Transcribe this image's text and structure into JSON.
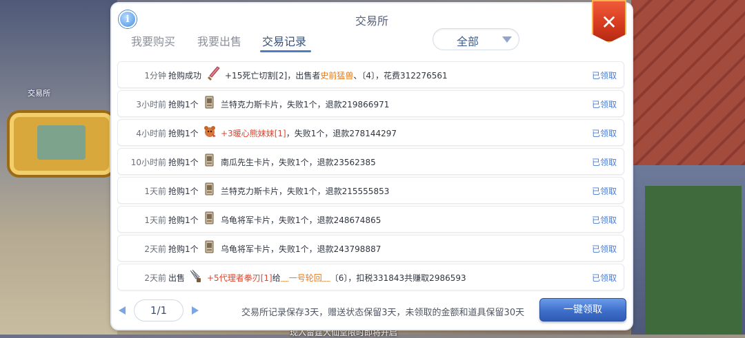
{
  "window": {
    "title": "交易所"
  },
  "tabs": [
    {
      "label": "我要购买",
      "active": false
    },
    {
      "label": "我要出售",
      "active": false
    },
    {
      "label": "交易记录",
      "active": true
    }
  ],
  "filter": {
    "selected": "全部"
  },
  "background": {
    "sign_label": "交易所",
    "bottom_text": "现入雷霆大仙堂限时即将开启"
  },
  "records": [
    {
      "time": "1分钟",
      "action": "抢购成功",
      "icon": "sword-icon",
      "desc_parts": [
        {
          "text": "+15死亡切割[2]，出售者"
        },
        {
          "text": "史前猛兽",
          "color": "orange"
        },
        {
          "text": "、〔4〕，花费312276561"
        }
      ],
      "status": "已领取"
    },
    {
      "time": "3小时前",
      "action": "抢购1个",
      "icon": "card-icon",
      "desc_parts": [
        {
          "text": "兰特克力斯卡片，失败1个，退款219866971"
        }
      ],
      "status": "已领取"
    },
    {
      "time": "4小时前",
      "action": "抢购1个",
      "icon": "bear-icon",
      "desc_parts": [
        {
          "text": "+3暖心熊妹妹[1]",
          "color": "red"
        },
        {
          "text": "，失败1个，退款278144297"
        }
      ],
      "status": "已领取"
    },
    {
      "time": "10小时前",
      "action": "抢购1个",
      "icon": "card-icon",
      "desc_parts": [
        {
          "text": "南瓜先生卡片，失败1个，退款23562385"
        }
      ],
      "status": "已领取"
    },
    {
      "time": "1天前",
      "action": "抢购1个",
      "icon": "card-icon",
      "desc_parts": [
        {
          "text": "兰特克力斯卡片，失败1个，退款215555853"
        }
      ],
      "status": "已领取"
    },
    {
      "time": "1天前",
      "action": "抢购1个",
      "icon": "card-icon",
      "desc_parts": [
        {
          "text": "乌龟将军卡片，失败1个，退款248674865"
        }
      ],
      "status": "已领取"
    },
    {
      "time": "2天前",
      "action": "抢购1个",
      "icon": "card-icon",
      "desc_parts": [
        {
          "text": "乌龟将军卡片，失败1个，退款243798887"
        }
      ],
      "status": "已领取"
    },
    {
      "time": "2天前",
      "action": "出售",
      "icon": "claw-icon",
      "desc_parts": [
        {
          "text": "+5代理者拳刃[1]",
          "color": "red"
        },
        {
          "text": "给"
        },
        {
          "text": "﹏一号轮回﹏",
          "color": "orange"
        },
        {
          "text": "〔6〕，扣税331843共赚取2986593"
        }
      ],
      "status": "已领取"
    }
  ],
  "pager": {
    "page": "1/1"
  },
  "footer": {
    "note": "交易所记录保存3天，赠送状态保留3天，未领取的金额和道具保留30天",
    "claim_all": "一键领取"
  },
  "colors": {
    "accent": "#4a7ad0",
    "orange": "#e77a1a",
    "red": "#e2432b",
    "close": "#d43a1e"
  }
}
